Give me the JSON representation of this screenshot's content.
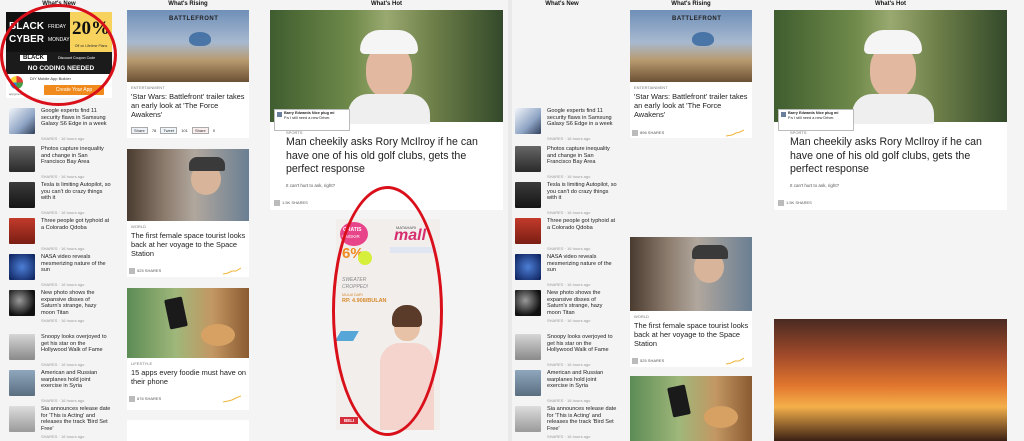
{
  "headers": {
    "whats_new": "What's New",
    "whats_rising": "What's Rising",
    "whats_hot": "What's Hot"
  },
  "ad_top": {
    "black": "BLACK",
    "friday": "FRIDAY",
    "cyber": "CYBER",
    "monday": "MONDAY",
    "pct": "20%",
    "off": "Off on Lifetime Plans",
    "coupon": "Discount Coupon Code",
    "black2": "BLACK",
    "nocode": "NO CODING NEEDED",
    "diy": "DIY Mobile App Builder",
    "cta": "Create Your App",
    "brand": "appypie.com"
  },
  "new_items": [
    {
      "text": "Google experts find 11 security flaws in Samsung Galaxy S6 Edge in a week",
      "meta": "SHARES · 16 hours ago"
    },
    {
      "text": "Photos capture inequality and change in San Francisco Bay Area",
      "meta": "SHARES · 16 hours ago"
    },
    {
      "text": "Tesla is limiting Autopilot, so you can't do crazy things with it",
      "meta": "SHARES · 16 hours ago"
    },
    {
      "text": "Three people got typhoid at a Colorado Qdoba",
      "meta": "SHARES · 16 hours ago"
    },
    {
      "text": "NASA video reveals mesmerizing nature of the sun",
      "meta": "SHARES · 16 hours ago"
    },
    {
      "text": "New photo shows the expansive disses of Saturn's strange, hazy moon Titan",
      "meta": "SHARES · 16 hours ago"
    },
    {
      "text": "Snoopy looks overjoyed to get his star on the Hollywood Walk of Fame",
      "meta": "SHARES · 16 hours ago"
    },
    {
      "text": "American and Russian warplanes hold joint exercise in Syria",
      "meta": "SHARES · 16 hours ago"
    },
    {
      "text": "Sia announces release date for 'This is Acting' and releases the track 'Bird Set Free'",
      "meta": "SHARES · 16 hours ago"
    }
  ],
  "rising": [
    {
      "category": "ENTERTAINMENT",
      "title": "'Star Wars: Battlefront' trailer takes an early look at 'The Force Awakens'",
      "shares": "896 SHARES",
      "battlefront": "BATTLEFRONT"
    },
    {
      "category": "WORLD",
      "title": "The first female space tourist looks back at her voyage to the Space Station",
      "shares": "525 SHARES"
    },
    {
      "category": "LIFESTYLE",
      "title": "15 apps every foodie must have on their phone",
      "shares": "676 SHARES"
    }
  ],
  "social": {
    "share": "Share",
    "share_n": "78",
    "tweet": "Tweet",
    "tweet_n": "101",
    "gplus": "Share",
    "gplus_n": "0"
  },
  "hot": {
    "category": "SPORTS",
    "title": "Man cheekily asks Rory McIlroy if he can have one of his old golf clubs, gets the perfect response",
    "dek": "It can't hurt to ask, right?",
    "shares": "1.5K SHARES",
    "tweet_name": "Barry Edwards Nice plug mi",
    "tweet_text": "P.s I still need a new Driver."
  },
  "ad_mid": {
    "gratis": "GRATIS",
    "ongkir": "ONGKIR",
    "pct": "6%",
    "brand": "MATAHARI",
    "mall": "mall",
    "sweater": "SWEATER CROPPED!",
    "mulai": "MULAI DARI",
    "price": "RP. 4.908/BULAN",
    "cta": "BELI"
  },
  "colors": {
    "annotation": "#d90f1a",
    "accent": "#2a7fd4",
    "ad_orange": "#f08a1c"
  }
}
